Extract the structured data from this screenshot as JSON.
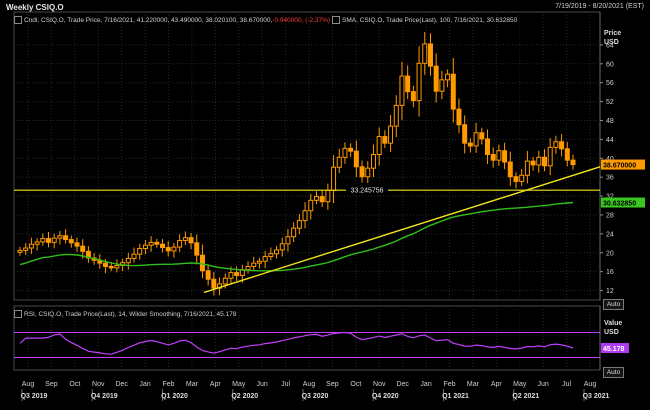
{
  "header": {
    "title": "Weekly CSIQ.O",
    "date_range": "7/19/2019 - 8/20/2021 (EST)"
  },
  "price_panel": {
    "legend_candles": {
      "prefix": "Cndl, CSIQ.O, Trade Price, 7/16/2021, 41.220000, 43.490000, 38.020100, 38.670000, ",
      "change": "-0.940000, (-2.37%)"
    },
    "legend_sma": "SMA, CSIQ.O, Trade Price(Last), 100, 7/16/2021, 30.632850",
    "axis_title": "Price",
    "axis_unit": "USD",
    "auto_label": "Auto",
    "last_price_tag": "38.670000",
    "sma_tag": "30.632850",
    "hline_label": "33.245756"
  },
  "rsi_panel": {
    "legend": "RSI, CSIQ.O, Trade Price(Last), 14, Wilder Smoothing, 7/16/2021, 45.178",
    "axis_title": "Value",
    "axis_unit": "USD",
    "auto_label": "Auto",
    "value_tag": "45.178"
  },
  "colors": {
    "candle": "#ff9a00",
    "sma": "#2fbf1a",
    "trendline": "#f2e21a",
    "rsi": "#c040ff",
    "tag_price": "#ff9a00",
    "tag_sma": "#39c61e",
    "tag_rsi": "#b03cf0"
  },
  "chart_data": [
    {
      "type": "candlestick",
      "title": "Weekly CSIQ.O",
      "ylabel": "Price USD",
      "ylim": [
        10,
        68
      ],
      "yticks": [
        12,
        16,
        20,
        24,
        28,
        32,
        36,
        40,
        44,
        48,
        52,
        56,
        60,
        64
      ],
      "x_tick_labels": [
        "Aug",
        "Sep",
        "Oct",
        "Nov",
        "Dec",
        "Jan",
        "Feb",
        "Mar",
        "Apr",
        "May",
        "Jun",
        "Jul",
        "Aug",
        "Sep",
        "Oct",
        "Nov",
        "Dec",
        "Jan",
        "Feb",
        "Mar",
        "Apr",
        "May",
        "Jun",
        "Jul",
        "Aug"
      ],
      "x_quarter_labels": [
        "Q3 2019",
        "Q4 2019",
        "Q1 2020",
        "Q2 2020",
        "Q3 2020",
        "Q4 2020",
        "Q1 2021",
        "Q2 2021",
        "Q3 2021"
      ],
      "candles_close": [
        20.5,
        21,
        21.8,
        22.3,
        23,
        22.2,
        23.1,
        23.6,
        22.8,
        22.1,
        21.4,
        20.3,
        18.9,
        18.4,
        17.8,
        17.1,
        16.8,
        17.3,
        17.9,
        18.8,
        19.7,
        20.9,
        21.6,
        22.2,
        21.8,
        21.1,
        20.4,
        21.2,
        22.6,
        23.2,
        22.1,
        19.5,
        16.2,
        14.4,
        12.5,
        13.4,
        14.6,
        15.8,
        15.2,
        16.4,
        17.1,
        17.8,
        18.2,
        19.2,
        19.8,
        20.6,
        21.9,
        23.4,
        25.2,
        26.8,
        28.9,
        31.1,
        31.9,
        30.8,
        33.2,
        38.1,
        40.2,
        42.1,
        41.5,
        38.2,
        36.1,
        37.9,
        40.8,
        44.6,
        43.2,
        46.8,
        51.2,
        57.4,
        54.1,
        52.2,
        60.1,
        64.2,
        59.5,
        54.2,
        56.6,
        57.8,
        50.4,
        47.1,
        43.2,
        42.6,
        45.4,
        44.1,
        40.8,
        39.6,
        41.6,
        39.2,
        36.1,
        35.1,
        36.4,
        39.4,
        38.6,
        40.2,
        38.4,
        42.3,
        43.5,
        42.0,
        39.6,
        38.67
      ],
      "sma_series": {
        "name": "SMA 100",
        "last_value": 30.63285
      },
      "horizontal_line": 33.245756,
      "last_price": 38.67
    },
    {
      "type": "line",
      "title": "RSI 14 Wilder Smoothing",
      "ylabel": "Value USD",
      "series": [
        {
          "name": "RSI",
          "last_value": 45.178
        }
      ]
    }
  ]
}
